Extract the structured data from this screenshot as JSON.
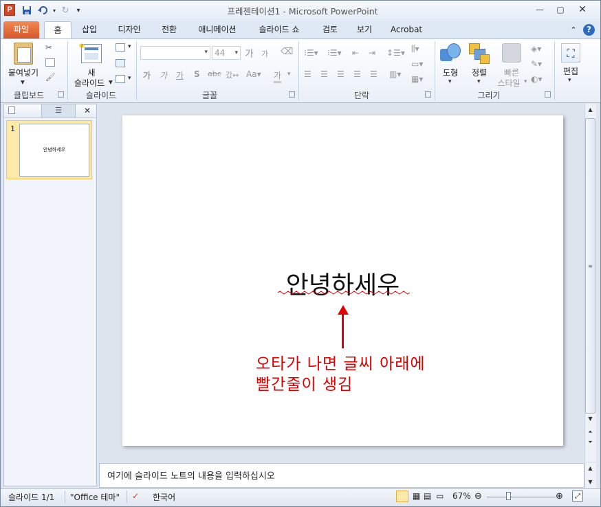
{
  "window": {
    "title": "프레젠테이션1  -  Microsoft PowerPoint",
    "app_icon": "P",
    "qat": [
      "save-icon",
      "undo-icon",
      "redo-icon",
      "customize-icon"
    ],
    "controls": [
      "minimize-icon",
      "maximize-icon",
      "close-icon"
    ]
  },
  "tabs": {
    "file": "파일",
    "items": [
      "홈",
      "삽입",
      "디자인",
      "전환",
      "애니메이션",
      "슬라이드 쇼",
      "검토",
      "보기",
      "Acrobat"
    ],
    "active": "홈"
  },
  "ribbon": {
    "clipboard": {
      "paste": "붙여넣기",
      "label": "클립보드"
    },
    "slides": {
      "new_slide_line1": "새",
      "new_slide_line2": "슬라이드",
      "label": "슬라이드"
    },
    "font": {
      "font_name": "",
      "font_size": "44",
      "label": "글꼴",
      "grow": "가",
      "shrink": "가"
    },
    "paragraph": {
      "label": "단락"
    },
    "drawing": {
      "shapes": "도형",
      "arrange": "정렬",
      "quick_styles_line1": "빠른",
      "quick_styles_line2": "스타일",
      "label": "그리기"
    },
    "editing": {
      "edit": "편집"
    }
  },
  "slides_panel": {
    "thumbnail_number": "1",
    "thumbnail_text": "안녕하세우"
  },
  "slide": {
    "title_text": "안녕하세우",
    "annotation_line1": "오타가 나면 글씨 아래에",
    "annotation_line2": "빨간줄이 생김"
  },
  "notes": {
    "placeholder": "여기에 슬라이드 노트의 내용을 입력하십시오"
  },
  "status": {
    "slide_info": "슬라이드 1/1",
    "theme": "\"Office 테마\"",
    "language": "한국어",
    "zoom": "67%"
  },
  "colors": {
    "annotation": "#e00000",
    "file_tab": "#d8572a",
    "selection": "#fde9a8"
  }
}
